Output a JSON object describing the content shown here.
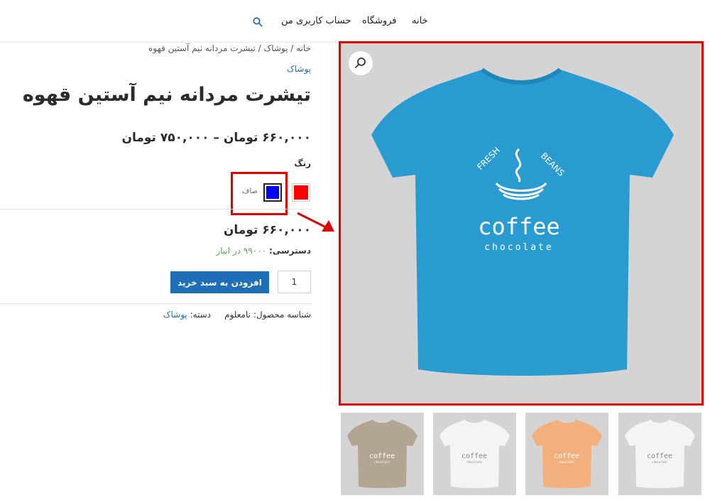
{
  "nav": {
    "home": "خانه",
    "shop": "فروشگاه",
    "account": "حساب کاربری من",
    "search_icon": "search-icon"
  },
  "breadcrumb": "خانه / پوشاک / تیشرت مردانه نیم آستین قهوه",
  "product": {
    "category": "پوشاک",
    "title": "تیشرت مردانه نیم آستین قهوه",
    "price_range": "۶۶۰,۰۰۰ تومان – ۷۵۰,۰۰۰ تومان",
    "color_label": "رنگ",
    "swatches": [
      {
        "name": "red",
        "color": "#ff0000"
      },
      {
        "name": "blue",
        "color": "#0000ff",
        "selected": true
      }
    ],
    "clear_label": "صاف",
    "variation_price": "۶۶۰,۰۰۰ تومان",
    "availability_label": "دسترسی:",
    "availability_value": "۹۹۰۰۰ در انبار",
    "quantity": "1",
    "add_to_cart": "افزودن به سبد خرید",
    "sku_label": "شناسه محصول:",
    "sku_value": "نامعلوم",
    "category_label": "دسته:",
    "category_value": "پوشاک"
  },
  "main_image": {
    "shirt_color": "#2a9bd0",
    "logo_top_left": "FRESH",
    "logo_top_right": "BEANS",
    "logo_main": "coffee",
    "logo_sub": "chocolate"
  },
  "thumbnails": [
    {
      "shirt_color": "#b3a593",
      "logo_main": "coffee",
      "logo_sub": "chocolate"
    },
    {
      "shirt_color": "#f4f4f4",
      "logo_main": "coffee",
      "logo_sub": "chocolate"
    },
    {
      "shirt_color": "#f2b07e",
      "logo_main": "coffee",
      "logo_sub": "chocolate"
    },
    {
      "shirt_color": "#f4f4f4",
      "logo_main": "coffee",
      "logo_sub": "chocolate"
    }
  ],
  "colors": {
    "accent": "#1e6fb8",
    "highlight": "#e00000",
    "in_stock": "#5aa84a"
  }
}
